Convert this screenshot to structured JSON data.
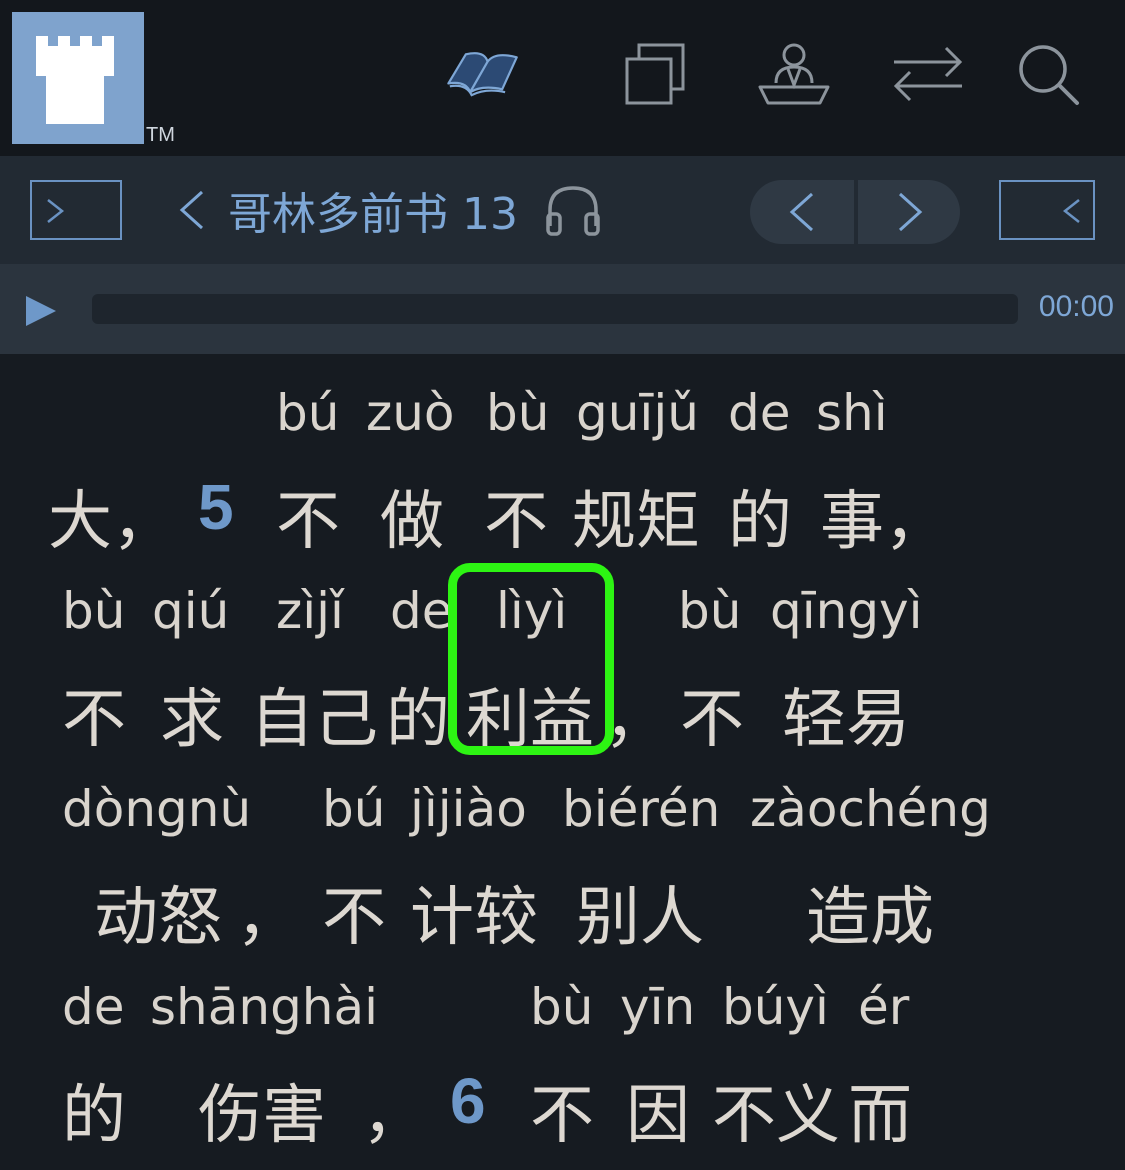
{
  "app": {
    "trademark": "TM"
  },
  "top_nav": {
    "icons": [
      "book-icon",
      "copy-icon",
      "person-at-desk-icon",
      "swap-arrows-icon",
      "search-icon"
    ]
  },
  "chapter_nav": {
    "title": "哥林多前书 13",
    "back_icon": "chevron-left-icon",
    "audio_icon": "headphones-icon"
  },
  "audio": {
    "time": "00:00",
    "progress": 0
  },
  "accent_colors": {
    "primary": "#7ea7d6",
    "verse_number": "#6e98c9",
    "highlight": "#2df413"
  },
  "lines": [
    {
      "pinyin": [
        "bú",
        "zuò",
        "bù",
        "guījǔ",
        "de",
        "shì"
      ],
      "hanzi": [
        "大，",
        "5",
        "不",
        "做",
        "不",
        "规矩",
        "的",
        "事，"
      ]
    },
    {
      "pinyin": [
        "bù",
        "qiú",
        "zìjǐ",
        "de",
        "lìyì",
        "bù",
        "qīngyì"
      ],
      "hanzi": [
        "不",
        "求",
        "自己",
        "的",
        "利益",
        "，",
        "不",
        "轻易"
      ]
    },
    {
      "pinyin": [
        "dòngnù",
        "bú",
        "jìjiào",
        "biérén",
        "zàochéng"
      ],
      "hanzi": [
        "动怒",
        "，",
        "不",
        "计较",
        "别人",
        "造成"
      ]
    },
    {
      "pinyin": [
        "de",
        "shānghài",
        "bù",
        "yīn",
        "búyì",
        "ér"
      ],
      "hanzi": [
        "的",
        "伤害",
        "，",
        "6",
        "不",
        "因",
        "不义",
        "而"
      ]
    }
  ],
  "selected_word": {
    "pinyin": "lìyì",
    "hanzi": "利益"
  }
}
